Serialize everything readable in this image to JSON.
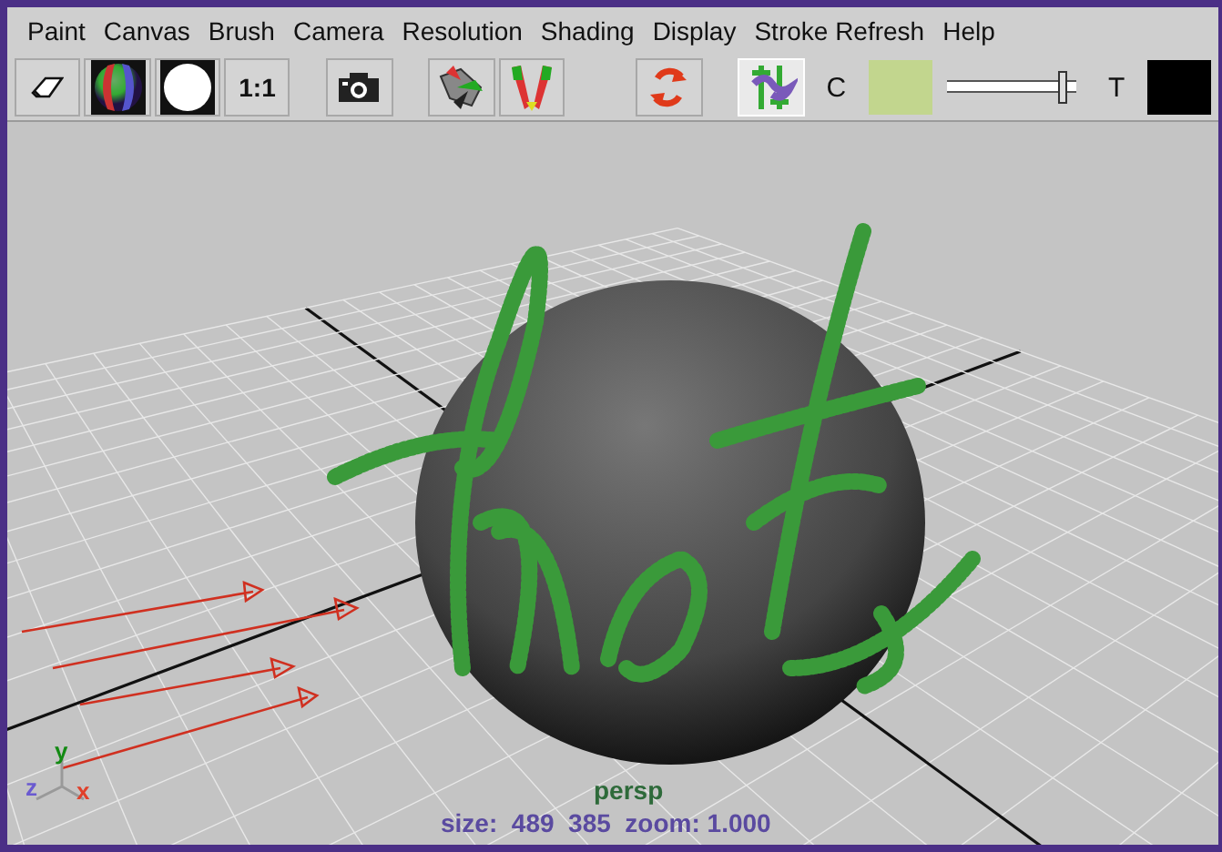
{
  "menu": [
    "Paint",
    "Canvas",
    "Brush",
    "Camera",
    "Resolution",
    "Shading",
    "Display",
    "Stroke Refresh",
    "Help"
  ],
  "toolbar": {
    "ratio_button": "1:1",
    "wrap_toggle": {
      "selected": true
    },
    "swatches": [
      {
        "label": "C",
        "color": "#c2d68e"
      },
      {
        "label": "T",
        "color": "#000000"
      }
    ],
    "slider": {
      "level": 0.94
    }
  },
  "viewport": {
    "axes": [
      {
        "kind": "y",
        "label": "y"
      },
      {
        "kind": "z",
        "label": "z"
      },
      {
        "kind": "x",
        "label": "x"
      }
    ],
    "status": "size:  489  385  zoom: 1.000",
    "camera": "persp"
  }
}
